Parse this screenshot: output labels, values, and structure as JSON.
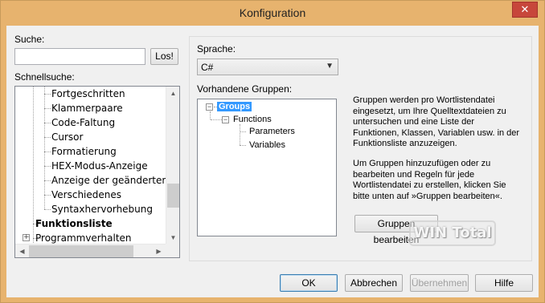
{
  "window": {
    "title": "Konfiguration",
    "close_label": "✕",
    "titlebar_color": "#e7b36e"
  },
  "left": {
    "search_label": "Suche:",
    "search_value": "",
    "search_button": "Los!",
    "quick_label": "Schnellsuche:",
    "tree_items": [
      {
        "label": "Fortgeschritten",
        "bold": false
      },
      {
        "label": "Klammerpaare",
        "bold": false
      },
      {
        "label": "Code-Faltung",
        "bold": false
      },
      {
        "label": "Cursor",
        "bold": false
      },
      {
        "label": "Formatierung",
        "bold": false
      },
      {
        "label": "HEX-Modus-Anzeige",
        "bold": false
      },
      {
        "label": "Anzeige der geänderten Zei",
        "bold": false
      },
      {
        "label": "Verschiedenes",
        "bold": false
      },
      {
        "label": "Syntaxhervorhebung",
        "bold": false
      },
      {
        "label": "Funktionsliste",
        "bold": true
      },
      {
        "label": "Programmverhalten",
        "bold": false
      }
    ]
  },
  "right": {
    "language_label": "Sprache:",
    "language_value": "C#",
    "groups_label": "Vorhandene Gruppen:",
    "groups_tree": [
      {
        "label": "Groups",
        "selected": true
      },
      {
        "label": "Functions",
        "selected": false
      },
      {
        "label": "Parameters",
        "selected": false
      },
      {
        "label": "Variables",
        "selected": false
      }
    ],
    "info_paragraph_1": "Gruppen werden pro Wortlistendatei eingesetzt, um Ihre Quelltextdateien zu untersuchen und eine Liste der Funktionen, Klassen, Variablen usw. in der Funktionsliste anzuzeigen.",
    "info_paragraph_2": "Um Gruppen hinzuzufügen oder zu bearbeiten und Regeln für jede Wortlistendatei zu erstellen, klicken Sie bitte unten auf »Gruppen bearbeiten«.",
    "edit_groups_button": "Gruppen bearbeiten"
  },
  "footer": {
    "ok": "OK",
    "cancel": "Abbrechen",
    "apply": "Übernehmen",
    "help": "Hilfe"
  },
  "watermark": "WIN Total"
}
